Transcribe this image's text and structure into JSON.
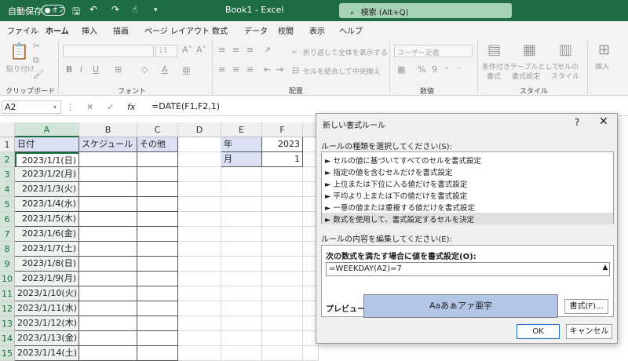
{
  "titlebar": {
    "autosave": "自動保存",
    "toggle": "オフ",
    "doc_title": "Book1  -  Excel",
    "search": "検索 (Alt+Q)"
  },
  "menu": [
    "ファイル",
    "ホーム",
    "挿入",
    "描画",
    "ページ レイアウト",
    "数式",
    "データ",
    "校閲",
    "表示",
    "ヘルプ"
  ],
  "ribbon": {
    "groups": [
      "クリップボード",
      "フォント",
      "配置",
      "数値",
      "スタイル"
    ],
    "paste": "貼り付け",
    "font_size": "11",
    "wrap_text": "折り返して全体を表示する",
    "merge": "セルを結合して中央揃え",
    "number_format": "ユーザー定義",
    "conditional": "条件付き",
    "conditional2": "書式",
    "as_table": "テーブルとして",
    "as_table2": "書式設定",
    "cell_style": "セルの",
    "cell_style2": "スタイル",
    "insert": "挿入"
  },
  "formula_bar": {
    "name_box": "A2",
    "fx": "fx",
    "formula": "=DATE(F1,F2,1)"
  },
  "sheet": {
    "columns": [
      "A",
      "B",
      "C",
      "D",
      "E",
      "F"
    ],
    "rows": [
      "1",
      "2",
      "3",
      "4",
      "5",
      "6",
      "7",
      "8",
      "9",
      "10",
      "11",
      "12",
      "13",
      "14",
      "15"
    ],
    "header_row": [
      "日付",
      "スケジュール",
      "その他"
    ],
    "dates": [
      "2023/1/1(日)",
      "2023/1/2(月)",
      "2023/1/3(火)",
      "2023/1/4(水)",
      "2023/1/5(木)",
      "2023/1/6(金)",
      "2023/1/7(土)",
      "2023/1/8(日)",
      "2023/1/9(月)",
      "2023/1/10(火)",
      "2023/1/11(水)",
      "2023/1/12(木)",
      "2023/1/13(金)",
      "2023/1/14(土)"
    ],
    "e1": "年",
    "f1": "2023",
    "e2": "月",
    "f2": "1",
    "header_fill": "#d9e1f2",
    "accent": "#1e6c41"
  },
  "dialog": {
    "title": "新しい書式ルール",
    "help": "?",
    "close": "✕",
    "select_type_label": "ルールの種類を選択してください(S):",
    "rules": [
      "► セルの値に基づいてすべてのセルを書式設定",
      "► 指定の値を含むセルだけを書式設定",
      "► 上位または下位に入る値だけを書式設定",
      "► 平均より上または下の値だけを書式設定",
      "► 一意の値または重複する値だけを書式設定",
      "► 数式を使用して、書式設定するセルを決定"
    ],
    "edit_label": "ルールの内容を編集してください(E):",
    "formula_label": "次の数式を満たす場合に値を書式設定(O):",
    "formula_value": "=WEEKDAY(A2)=7",
    "preview_label": "プレビュー:",
    "preview_text": "Aaあぁアァ亜宇",
    "format_button": "書式(F)...",
    "ok": "OK",
    "cancel": "キャンセル",
    "preview_fill": "#b4c6e7"
  }
}
